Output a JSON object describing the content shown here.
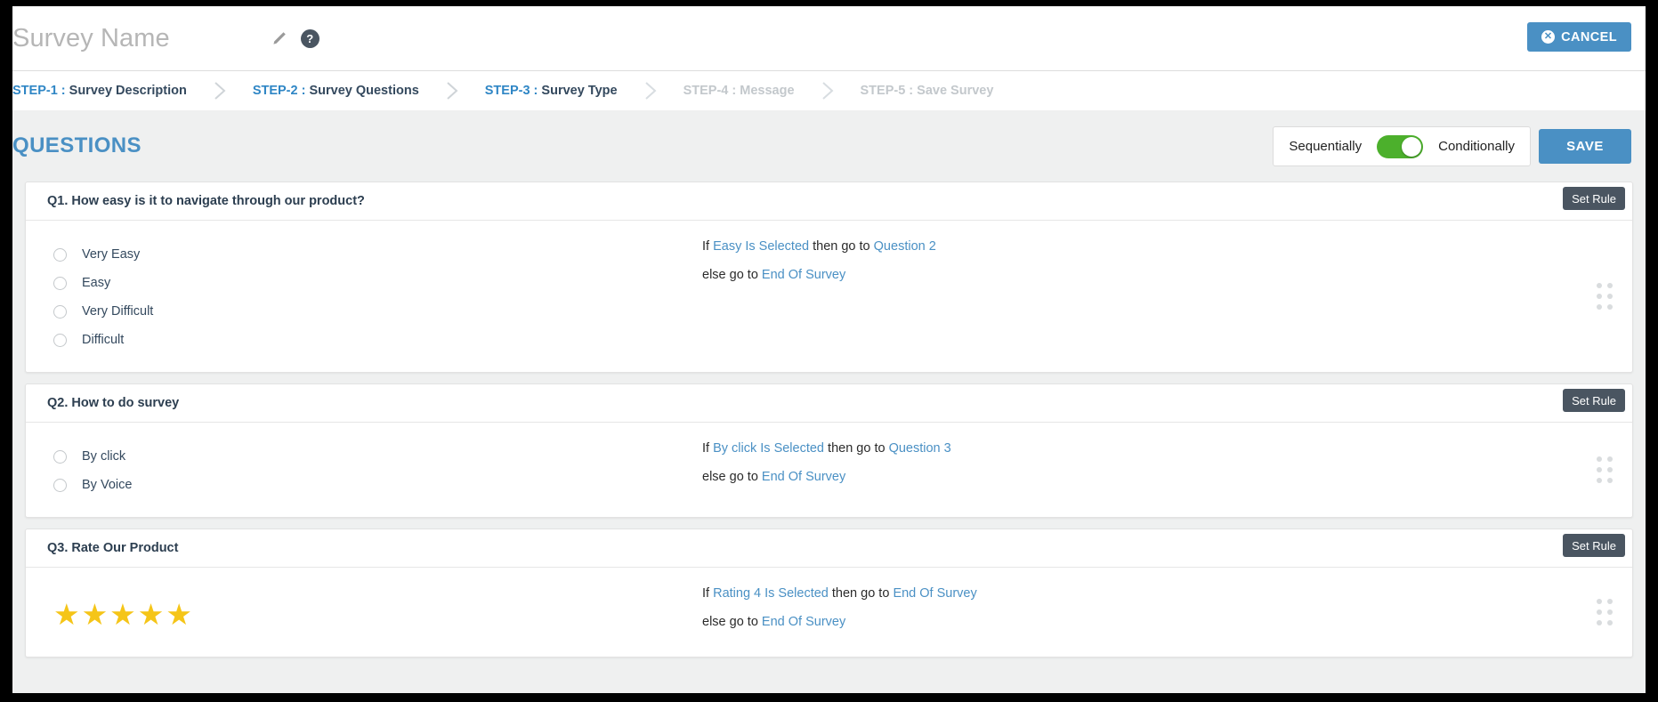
{
  "header": {
    "survey_name_placeholder": "Survey Name",
    "edit_icon": "pencil-icon",
    "help_icon": "help-icon",
    "help_glyph": "?",
    "cancel_label": "CANCEL",
    "cancel_glyph": "✕"
  },
  "steps": [
    {
      "num": "STEP-1 :",
      "label": " Survey Description",
      "state": "active"
    },
    {
      "num": "STEP-2 :",
      "label": " Survey Questions",
      "state": "active"
    },
    {
      "num": "STEP-3 :",
      "label": " Survey Type",
      "state": "active"
    },
    {
      "num": "STEP-4 :",
      "label": " Message",
      "state": "inactive"
    },
    {
      "num": "STEP-5 :",
      "label": " Save Survey",
      "state": "inactive"
    }
  ],
  "section": {
    "title": "QUESTIONS",
    "toggle_left_label": "Sequentially",
    "toggle_right_label": "Conditionally",
    "toggle_state": "on",
    "save_label": "SAVE"
  },
  "rule_words": {
    "if": "If",
    "then": " then go to ",
    "else": "else go to "
  },
  "questions": [
    {
      "title": "Q1. How easy is it to navigate through our product?",
      "set_rule_label": "Set Rule",
      "input_type": "radio",
      "options": [
        "Very Easy",
        "Easy",
        "Very Difficult",
        "Difficult"
      ],
      "rule": {
        "condition": "Easy Is Selected",
        "then_target": "Question 2",
        "else_target": "End Of Survey"
      }
    },
    {
      "title": "Q2. How to do survey",
      "set_rule_label": "Set Rule",
      "input_type": "radio",
      "options": [
        "By click",
        "By Voice"
      ],
      "rule": {
        "condition": "By click Is Selected",
        "then_target": "Question 3",
        "else_target": "End Of Survey"
      }
    },
    {
      "title": "Q3. Rate Our Product",
      "set_rule_label": "Set Rule",
      "input_type": "stars",
      "stars": "★★★★★",
      "star_count": 5,
      "options": [],
      "rule": {
        "condition": "Rating 4 Is Selected",
        "then_target": "End Of Survey",
        "else_target": "End Of Survey"
      }
    }
  ],
  "colors": {
    "accent_blue": "#4a90c4",
    "link_blue": "#4a90c4",
    "toggle_green": "#4cb02c",
    "dark_slate": "#4a5561",
    "star_gold": "#f5c518",
    "page_bg": "#eff0f0"
  }
}
